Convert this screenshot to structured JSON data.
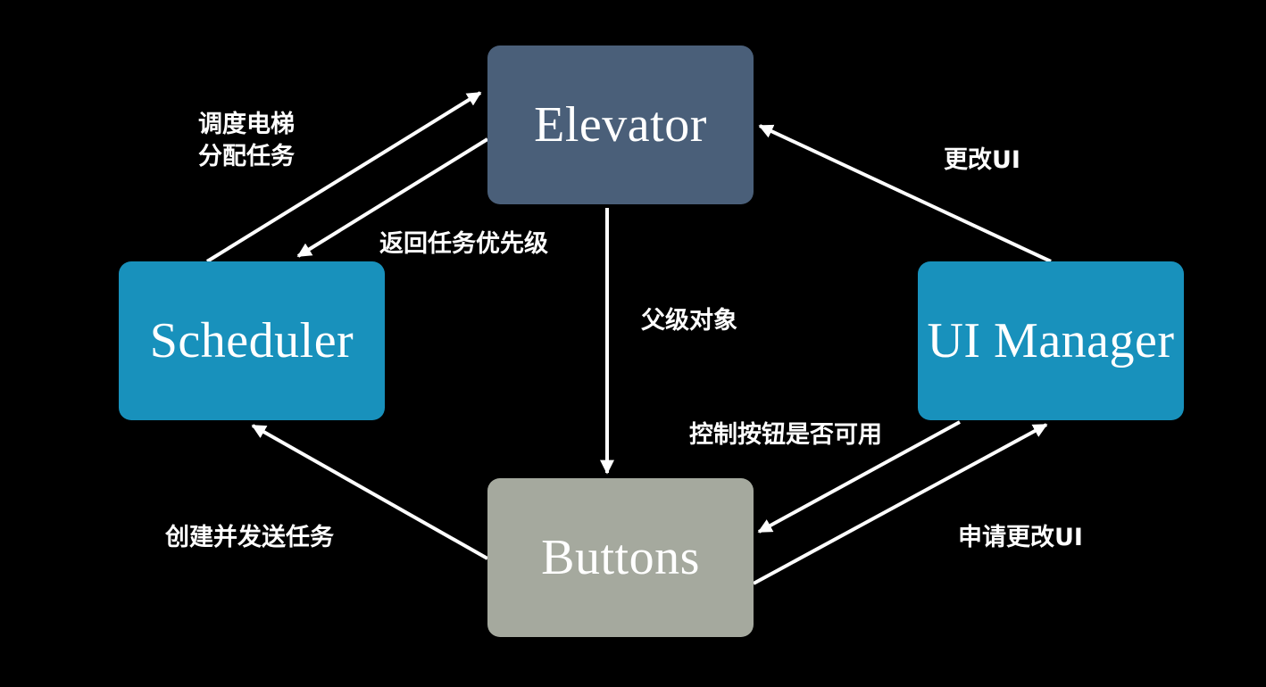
{
  "colors": {
    "background": "#000000",
    "edge": "#ffffff",
    "elevator": "#4a5f79",
    "scheduler": "#1891bc",
    "ui_manager": "#1891bc",
    "buttons": "#a5a99e",
    "text": "#ffffff"
  },
  "nodes": {
    "elevator": "Elevator",
    "scheduler": "Scheduler",
    "ui_manager": "UI Manager",
    "buttons": "Buttons"
  },
  "edges": [
    {
      "from": "scheduler",
      "to": "elevator",
      "label_lines": [
        "调度电梯",
        "分配任务"
      ]
    },
    {
      "from": "elevator",
      "to": "scheduler",
      "label_lines": [
        "返回任务优先级"
      ]
    },
    {
      "from": "ui_manager",
      "to": "elevator",
      "label_lines": [
        "更改UI"
      ]
    },
    {
      "from": "elevator",
      "to": "buttons",
      "label_lines": [
        "父级对象"
      ]
    },
    {
      "from": "ui_manager",
      "to": "buttons",
      "label_lines": [
        "控制按钮是否可用"
      ]
    },
    {
      "from": "buttons",
      "to": "scheduler",
      "label_lines": [
        "创建并发送任务"
      ]
    },
    {
      "from": "buttons",
      "to": "ui_manager",
      "label_lines": [
        "申请更改UI"
      ]
    }
  ]
}
